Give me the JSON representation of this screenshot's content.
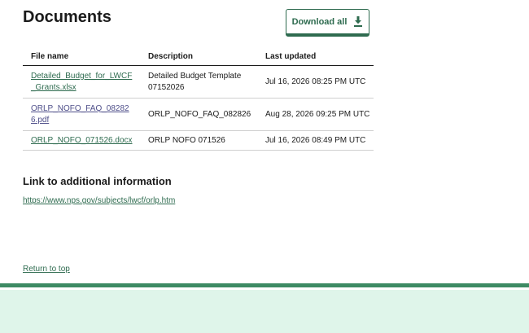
{
  "documents": {
    "title": "Documents",
    "download_all_label": "Download all",
    "columns": [
      "File name",
      "Description",
      "Last updated"
    ],
    "rows": [
      {
        "file": "Detailed_Budget_for_LWCF_Grants.xlsx",
        "description": "Detailed Budget Template 07152026",
        "updated": "Jul 16, 2026 08:25 PM UTC"
      },
      {
        "file": "ORLP_NOFO_FAQ_082826.pdf",
        "description": "ORLP_NOFO_FAQ_082826",
        "updated": "Aug 28, 2026 09:25 PM UTC"
      },
      {
        "file": "ORLP_NOFO_071526.docx",
        "description": "ORLP NOFO 071526",
        "updated": "Jul 16, 2026 08:49 PM UTC"
      }
    ]
  },
  "additional": {
    "heading": "Link to additional information",
    "link": "https://www.nps.gov/subjects/lwcf/orlp.htm"
  },
  "return_to_top": "Return to top",
  "colors": {
    "accent": "#2e6b4f",
    "footer_bg": "#dff5ea",
    "footer_stripe": "#3d8a63"
  }
}
